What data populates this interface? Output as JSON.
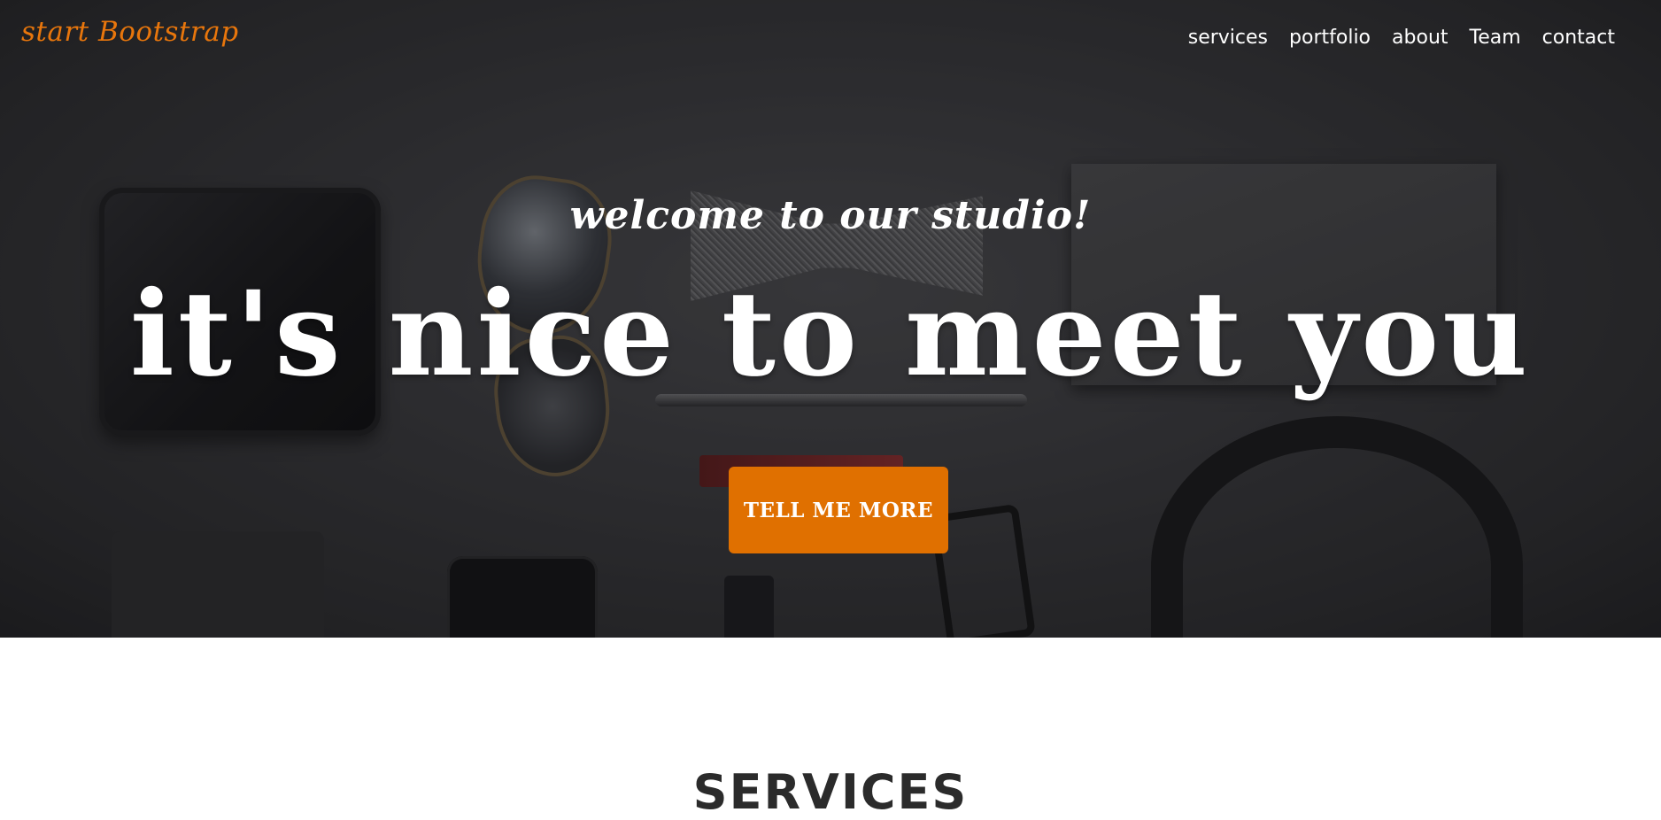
{
  "brand": {
    "name": "start Bootstrap",
    "color": "#e8760c"
  },
  "nav": {
    "items": [
      {
        "label": "services"
      },
      {
        "label": "portfolio"
      },
      {
        "label": "about"
      },
      {
        "label": "Team"
      },
      {
        "label": "contact"
      }
    ]
  },
  "hero": {
    "subtitle": "welcome to our studio!",
    "headline": "it's nice to meet you",
    "cta_label": "TELL ME MORE",
    "cta_color": "#e07000"
  },
  "services": {
    "title": "SERVICES"
  }
}
